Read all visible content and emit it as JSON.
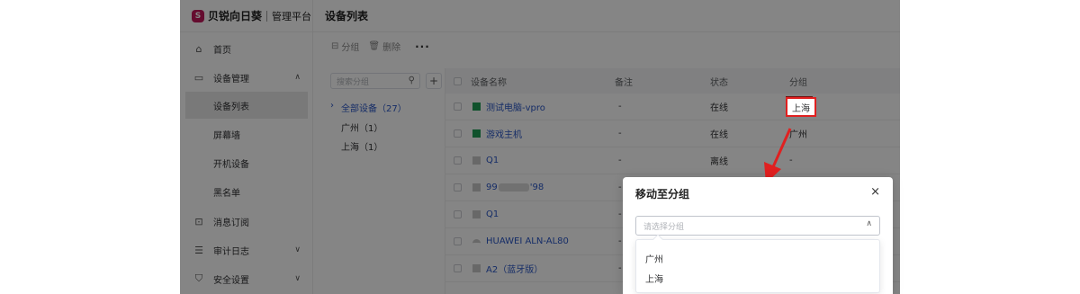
{
  "brand": {
    "name": "贝锐向日葵",
    "sub": "管理平台",
    "logo_letter": "S"
  },
  "sidebar": {
    "items": [
      {
        "label": "首页",
        "icon": "home-icon"
      },
      {
        "label": "设备管理",
        "icon": "monitor-icon",
        "expanded": true
      },
      {
        "label": "设备列表",
        "active": true
      },
      {
        "label": "屏幕墙"
      },
      {
        "label": "开机设备"
      },
      {
        "label": "黑名单"
      },
      {
        "label": "消息订阅",
        "icon": "message-icon"
      },
      {
        "label": "审计日志",
        "icon": "log-icon"
      },
      {
        "label": "安全设置",
        "icon": "shield-icon"
      }
    ]
  },
  "header": {
    "title": "设备列表"
  },
  "toolbar": {
    "group_label": "分组",
    "delete_label": "删除",
    "more_label": "···"
  },
  "groups": {
    "search_placeholder": "搜索分组",
    "add_label": "+",
    "items": [
      {
        "label": "全部设备（27）",
        "active": true
      },
      {
        "label": "广州（1）"
      },
      {
        "label": "上海（1）"
      }
    ]
  },
  "table": {
    "columns": [
      "设备名称",
      "备注",
      "状态",
      "分组"
    ],
    "rows": [
      {
        "name": "测试电脑-vpro",
        "note": "-",
        "status": "在线",
        "group": "上海",
        "icon": "green"
      },
      {
        "name": "游戏主机",
        "note": "-",
        "status": "在线",
        "group": "广州",
        "icon": "green"
      },
      {
        "name": "Q1",
        "note": "-",
        "status": "离线",
        "group": "-",
        "icon": "gray"
      },
      {
        "name_prefix": "99",
        "name_suffix": "'98",
        "note": "-",
        "icon": "gray"
      },
      {
        "name": "Q1",
        "note": "-",
        "icon": "gray"
      },
      {
        "name": "HUAWEI ALN-AL80",
        "note": "-",
        "icon": "phone"
      },
      {
        "name": "A2（蓝牙版）",
        "note": "-",
        "icon": "gray"
      }
    ]
  },
  "dialog": {
    "title": "移动至分组",
    "close_label": "×",
    "select_placeholder": "请选择分组",
    "options": [
      "广州",
      "上海"
    ]
  },
  "colors": {
    "accent": "#2a56c6",
    "highlight": "#e02020",
    "brand": "#c2185b",
    "online_icon": "#1f9d55"
  }
}
